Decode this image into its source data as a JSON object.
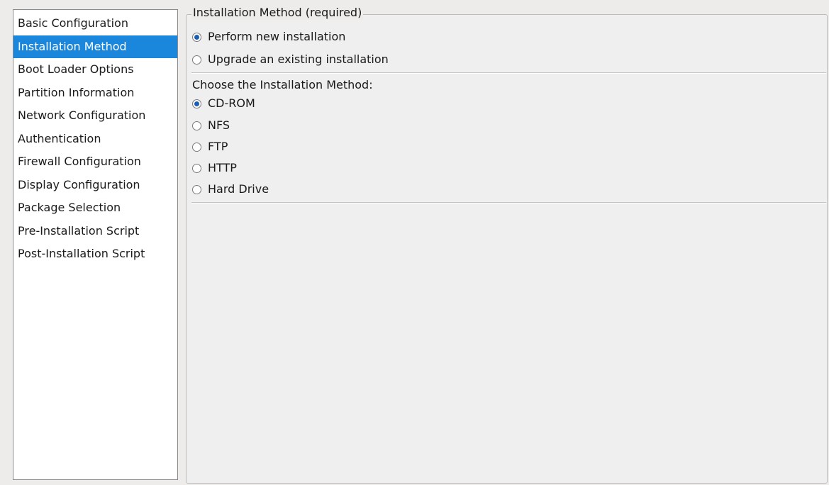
{
  "sidebar": {
    "items": [
      {
        "label": "Basic Configuration"
      },
      {
        "label": "Installation Method"
      },
      {
        "label": "Boot Loader Options"
      },
      {
        "label": "Partition Information"
      },
      {
        "label": "Network Configuration"
      },
      {
        "label": "Authentication"
      },
      {
        "label": "Firewall Configuration"
      },
      {
        "label": "Display Configuration"
      },
      {
        "label": "Package Selection"
      },
      {
        "label": "Pre-Installation Script"
      },
      {
        "label": "Post-Installation Script"
      }
    ],
    "selected": "Installation Method",
    "selected_color": "#1a87dd"
  },
  "panel": {
    "title": "Installation Method (required)",
    "install_type": {
      "options": [
        {
          "label": "Perform new installation",
          "checked": true
        },
        {
          "label": "Upgrade an existing installation",
          "checked": false
        }
      ]
    },
    "method": {
      "label": "Choose the Installation Method:",
      "options": [
        {
          "label": "CD-ROM",
          "checked": true
        },
        {
          "label": "NFS",
          "checked": false
        },
        {
          "label": "FTP",
          "checked": false
        },
        {
          "label": "HTTP",
          "checked": false
        },
        {
          "label": "Hard Drive",
          "checked": false
        }
      ]
    }
  }
}
